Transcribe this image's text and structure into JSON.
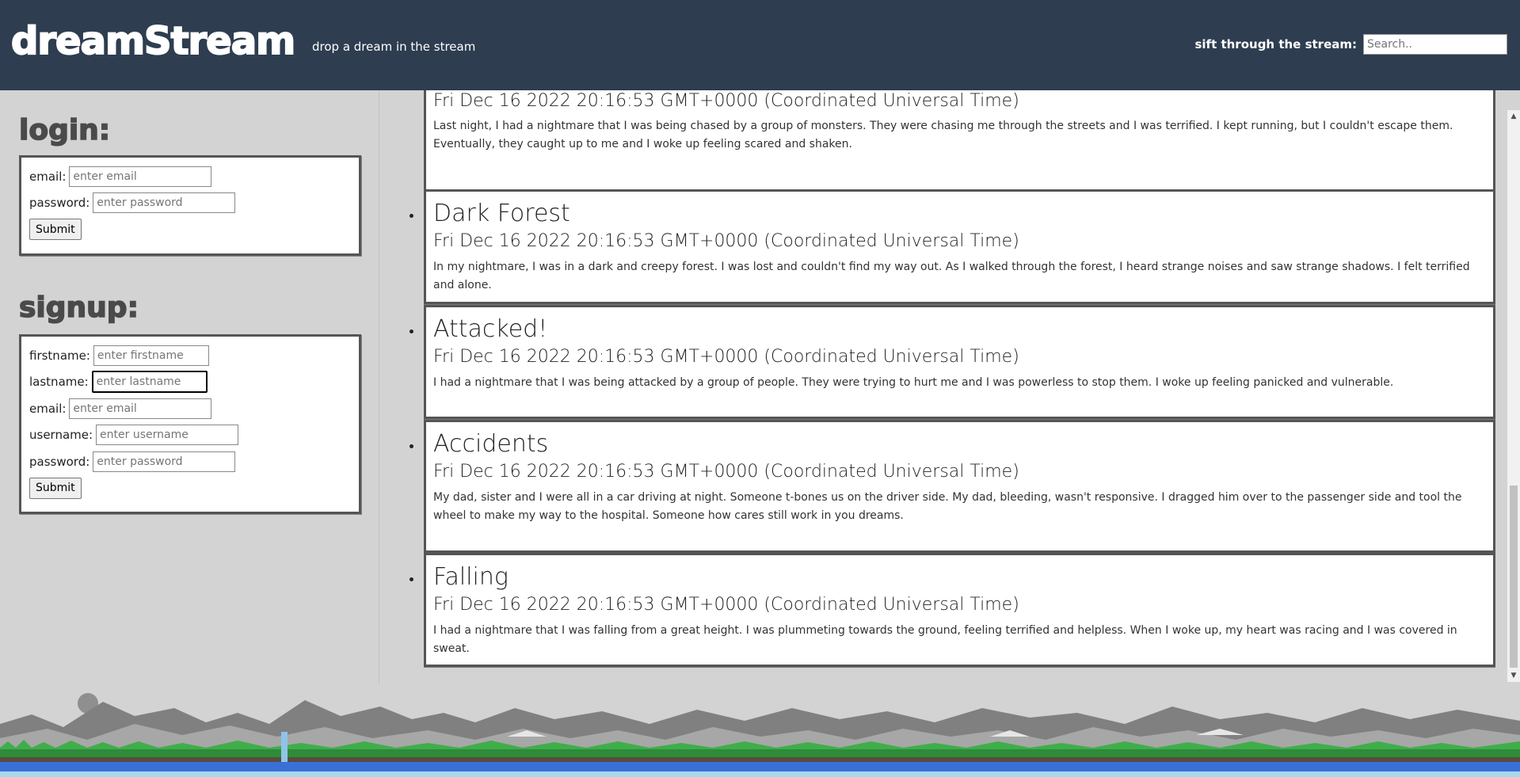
{
  "header": {
    "logo": "dreamStream",
    "tagline": "drop a dream in the stream",
    "search_label": "sift through the stream:",
    "search_placeholder": "Search.."
  },
  "login": {
    "title": "login:",
    "fields": [
      {
        "label": "email:",
        "placeholder": "enter email"
      },
      {
        "label": "password:",
        "placeholder": "enter password"
      }
    ],
    "submit": "Submit"
  },
  "signup": {
    "title": "signup:",
    "fields": [
      {
        "label": "firstname:",
        "placeholder": "enter firstname"
      },
      {
        "label": "lastname:",
        "placeholder": "enter lastname"
      },
      {
        "label": "email:",
        "placeholder": "enter email"
      },
      {
        "label": "username:",
        "placeholder": "enter username"
      },
      {
        "label": "password:",
        "placeholder": "enter password"
      }
    ],
    "submit": "Submit"
  },
  "dreams": [
    {
      "title": "",
      "date": "Fri Dec 16 2022 20:16:53 GMT+0000 (Coordinated Universal Time)",
      "body": "Last night, I had a nightmare that I was being chased by a group of monsters. They were chasing me through the streets and I was terrified. I kept running, but I couldn't escape them. Eventually, they caught up to me and I woke up feeling scared and shaken."
    },
    {
      "title": "Dark Forest",
      "date": "Fri Dec 16 2022 20:16:53 GMT+0000 (Coordinated Universal Time)",
      "body": "In my nightmare, I was in a dark and creepy forest. I was lost and couldn't find my way out. As I walked through the forest, I heard strange noises and saw strange shadows. I felt terrified and alone."
    },
    {
      "title": "Attacked!",
      "date": "Fri Dec 16 2022 20:16:53 GMT+0000 (Coordinated Universal Time)",
      "body": "I had a nightmare that I was being attacked by a group of people. They were trying to hurt me and I was powerless to stop them. I woke up feeling panicked and vulnerable."
    },
    {
      "title": "Accidents",
      "date": "Fri Dec 16 2022 20:16:53 GMT+0000 (Coordinated Universal Time)",
      "body": "My dad, sister and I were all in a car driving at night. Someone t-bones us on the driver side. My dad, bleeding, wasn't responsive. I dragged him over to the passenger side and tool the wheel to make my way to the hospital. Someone how cares still work in you dreams."
    },
    {
      "title": "Falling",
      "date": "Fri Dec 16 2022 20:16:53 GMT+0000 (Coordinated Universal Time)",
      "body": "I had a nightmare that I was falling from a great height. I was plummeting towards the ground, feeling terrified and helpless. When I woke up, my heart was racing and I was covered in sweat."
    }
  ],
  "scrollbar": {
    "up_icon": "triangle-up-icon",
    "down_icon": "triangle-down-icon"
  }
}
